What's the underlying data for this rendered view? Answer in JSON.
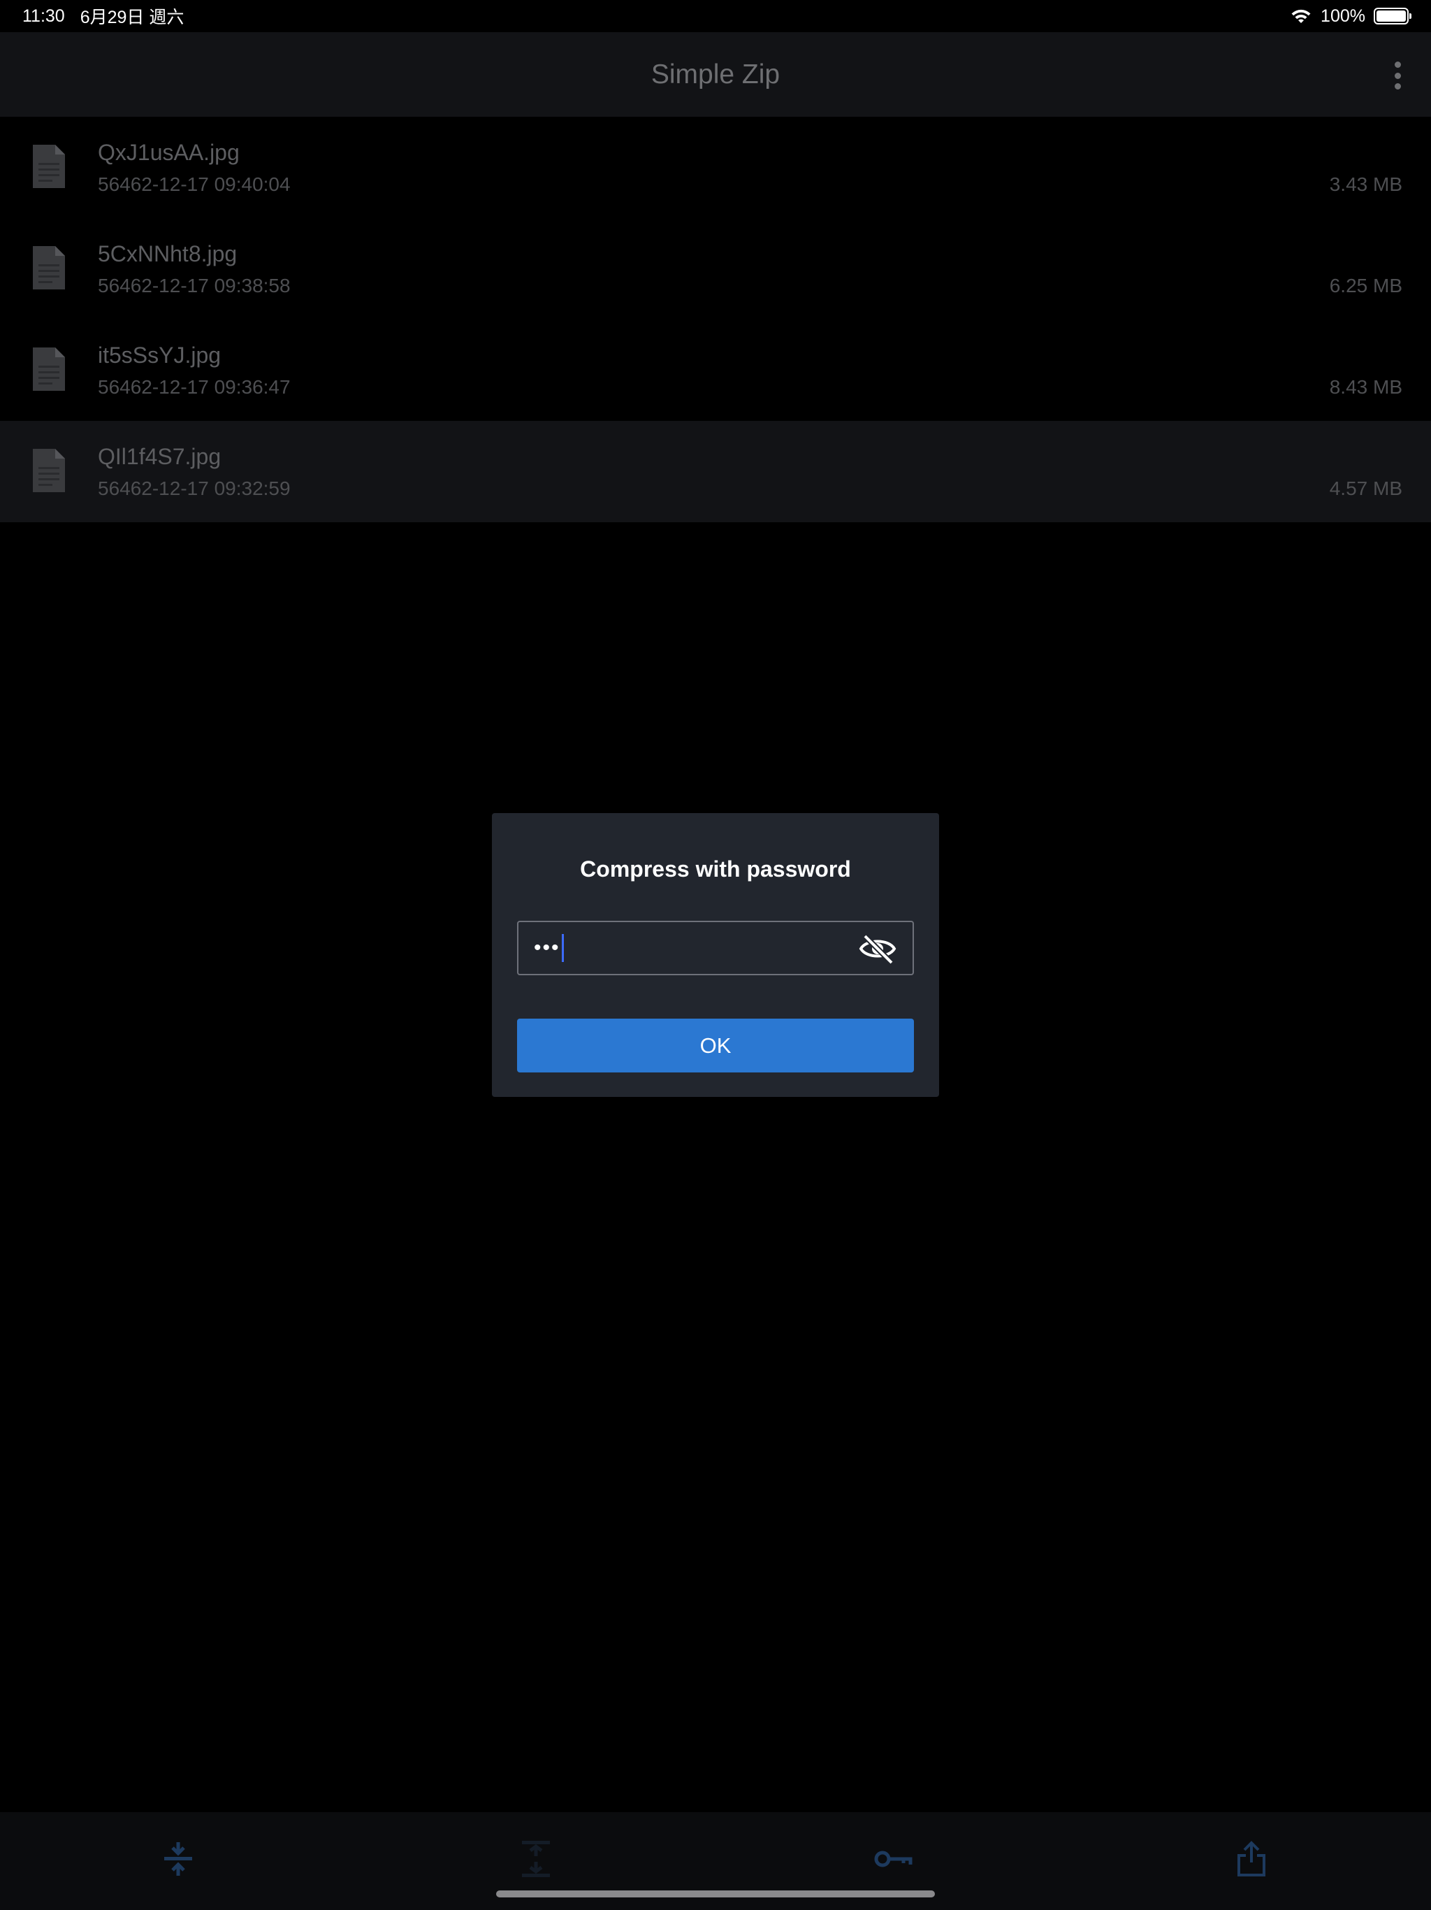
{
  "status_bar": {
    "time": "11:30",
    "date": "6月29日 週六",
    "battery": "100%"
  },
  "app_bar": {
    "title": "Simple Zip"
  },
  "files": [
    {
      "name": "QxJ1usAA.jpg",
      "date": "56462-12-17 09:40:04",
      "size": "3.43 MB",
      "selected": false
    },
    {
      "name": "5CxNNht8.jpg",
      "date": "56462-12-17 09:38:58",
      "size": "6.25 MB",
      "selected": false
    },
    {
      "name": "it5sSsYJ.jpg",
      "date": "56462-12-17 09:36:47",
      "size": "8.43 MB",
      "selected": false
    },
    {
      "name": "QIl1f4S7.jpg",
      "date": "56462-12-17 09:32:59",
      "size": "4.57 MB",
      "selected": true
    }
  ],
  "dialog": {
    "title": "Compress with password",
    "password_masked": "•••",
    "ok_label": "OK"
  },
  "toolbar": {
    "items": [
      "compress-icon",
      "extract-icon",
      "key-icon",
      "share-icon"
    ]
  },
  "colors": {
    "accent": "#2b78d2",
    "dialog_bg": "#22262e",
    "app_bar_bg": "#121316",
    "toolbar_icon": "#1d3a5e"
  }
}
